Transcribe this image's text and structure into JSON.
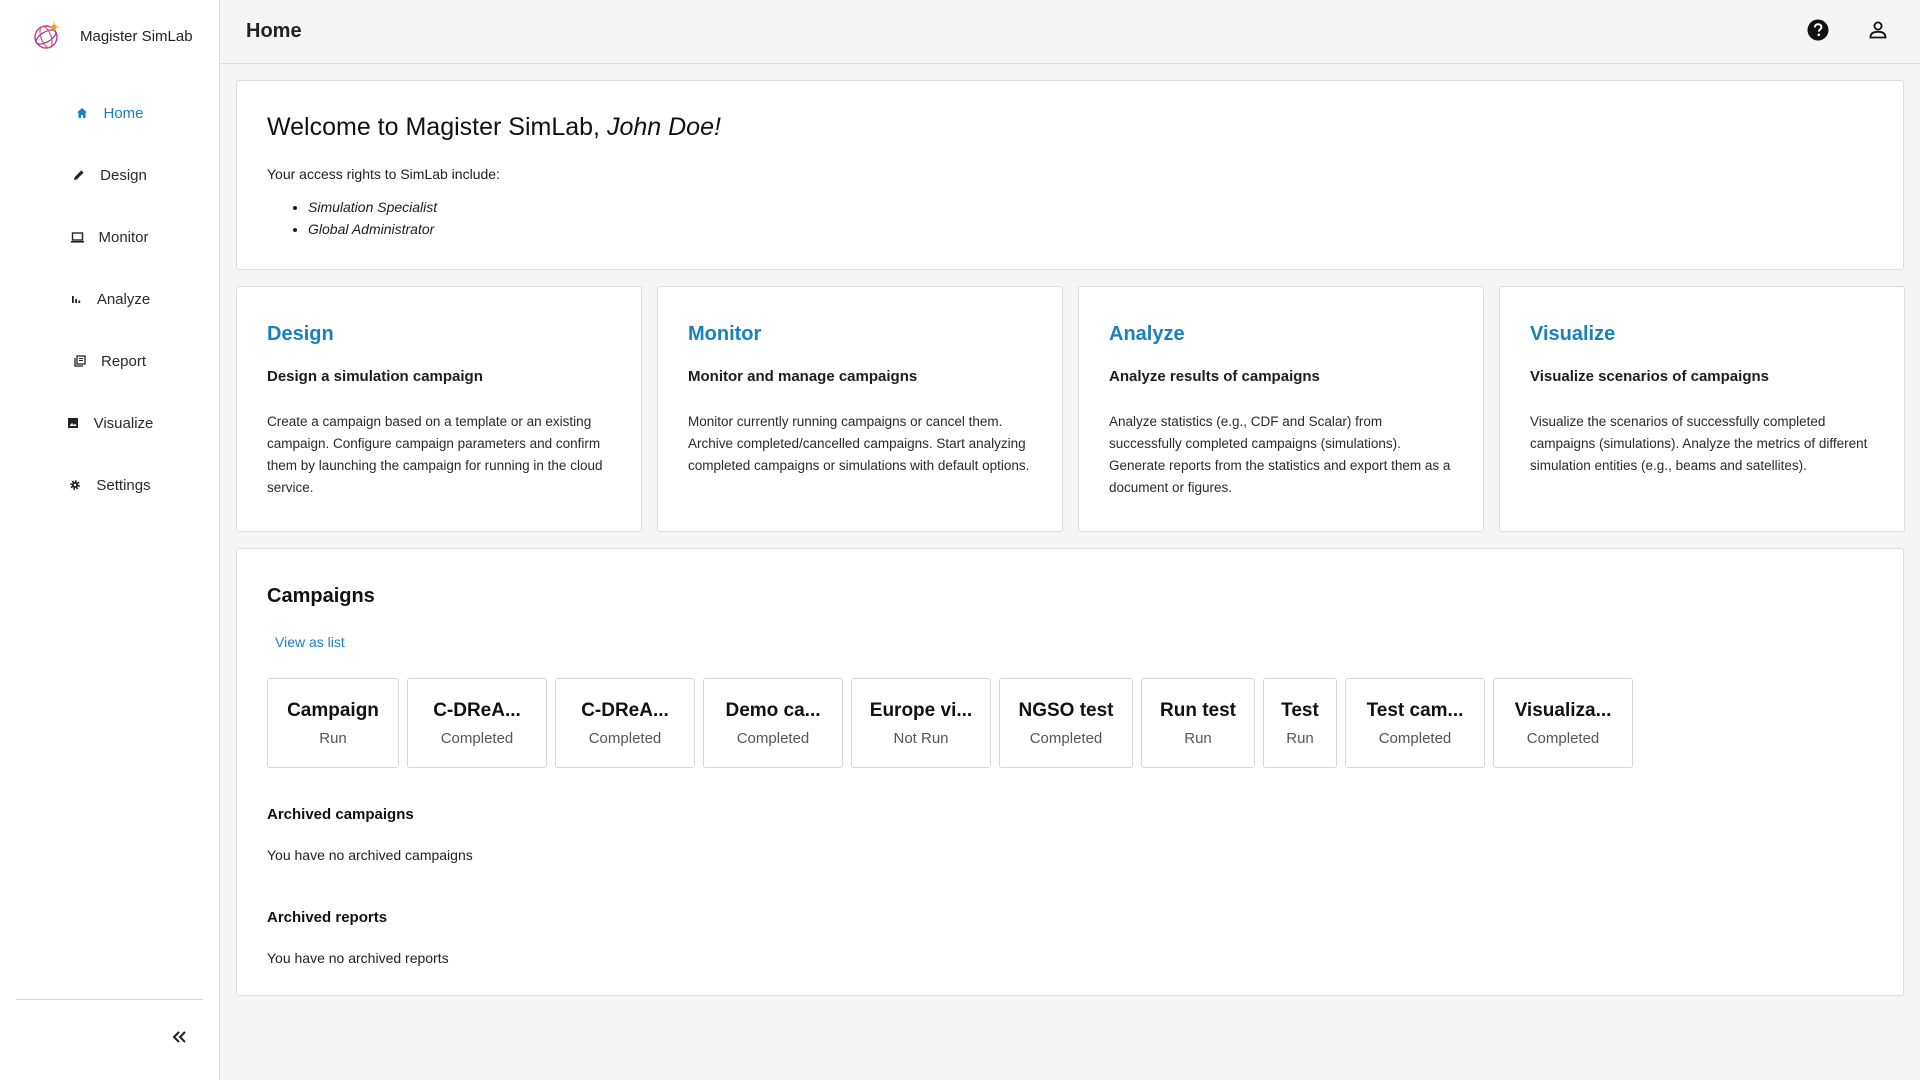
{
  "app": {
    "name": "Magister SimLab",
    "page_title": "Home"
  },
  "sidebar": {
    "items": [
      {
        "label": "Home",
        "icon": "home-icon",
        "active": true
      },
      {
        "label": "Design",
        "icon": "pencil-icon",
        "active": false
      },
      {
        "label": "Monitor",
        "icon": "monitor-icon",
        "active": false
      },
      {
        "label": "Analyze",
        "icon": "bar-chart-icon",
        "active": false
      },
      {
        "label": "Report",
        "icon": "report-icon",
        "active": false
      },
      {
        "label": "Visualize",
        "icon": "image-icon",
        "active": false
      },
      {
        "label": "Settings",
        "icon": "gear-icon",
        "active": false
      }
    ],
    "collapse_icon": "double-chevron-left-icon"
  },
  "topbar": {
    "help_icon": "help-icon",
    "account_icon": "account-icon"
  },
  "welcome": {
    "title_prefix": "Welcome to Magister SimLab, ",
    "user_name": "John Doe!",
    "access_text": "Your access rights to SimLab include:",
    "roles": [
      "Simulation Specialist",
      "Global Administrator"
    ]
  },
  "features": [
    {
      "title": "Design",
      "subtitle": "Design a simulation campaign",
      "description": "Create a campaign based on a template or an existing campaign. Configure campaign parameters and confirm them by launching the campaign for running in the cloud service."
    },
    {
      "title": "Monitor",
      "subtitle": "Monitor and manage campaigns",
      "description": "Monitor currently running campaigns or cancel them. Archive completed/cancelled campaigns. Start analyzing completed campaigns or simulations with default options."
    },
    {
      "title": "Analyze",
      "subtitle": "Analyze results of campaigns",
      "description": "Analyze statistics (e.g., CDF and Scalar) from successfully completed campaigns (simulations). Generate reports from the statistics and export them as a document or figures."
    },
    {
      "title": "Visualize",
      "subtitle": "Visualize scenarios of campaigns",
      "description": "Visualize the scenarios of successfully completed campaigns (simulations). Analyze the metrics of different simulation entities (e.g., beams and satellites)."
    }
  ],
  "campaigns": {
    "title": "Campaigns",
    "view_as_list": "View as list",
    "items": [
      {
        "name": "Campaign",
        "status": "Run"
      },
      {
        "name": "C-DReA...",
        "status": "Completed"
      },
      {
        "name": "C-DReA...",
        "status": "Completed"
      },
      {
        "name": "Demo ca...",
        "status": "Completed"
      },
      {
        "name": "Europe vi...",
        "status": "Not Run"
      },
      {
        "name": "NGSO test",
        "status": "Completed"
      },
      {
        "name": "Run test",
        "status": "Run"
      },
      {
        "name": "Test",
        "status": "Run"
      },
      {
        "name": "Test cam...",
        "status": "Completed"
      },
      {
        "name": "Visualiza...",
        "status": "Completed"
      }
    ],
    "archived_campaigns_title": "Archived campaigns",
    "archived_campaigns_text": "You have no archived campaigns",
    "archived_reports_title": "Archived reports",
    "archived_reports_text": "You have no archived reports"
  },
  "colors": {
    "accent": "#1a7fbf",
    "background": "#f5f5f5",
    "card": "#ffffff",
    "border": "#dcdcdc"
  }
}
